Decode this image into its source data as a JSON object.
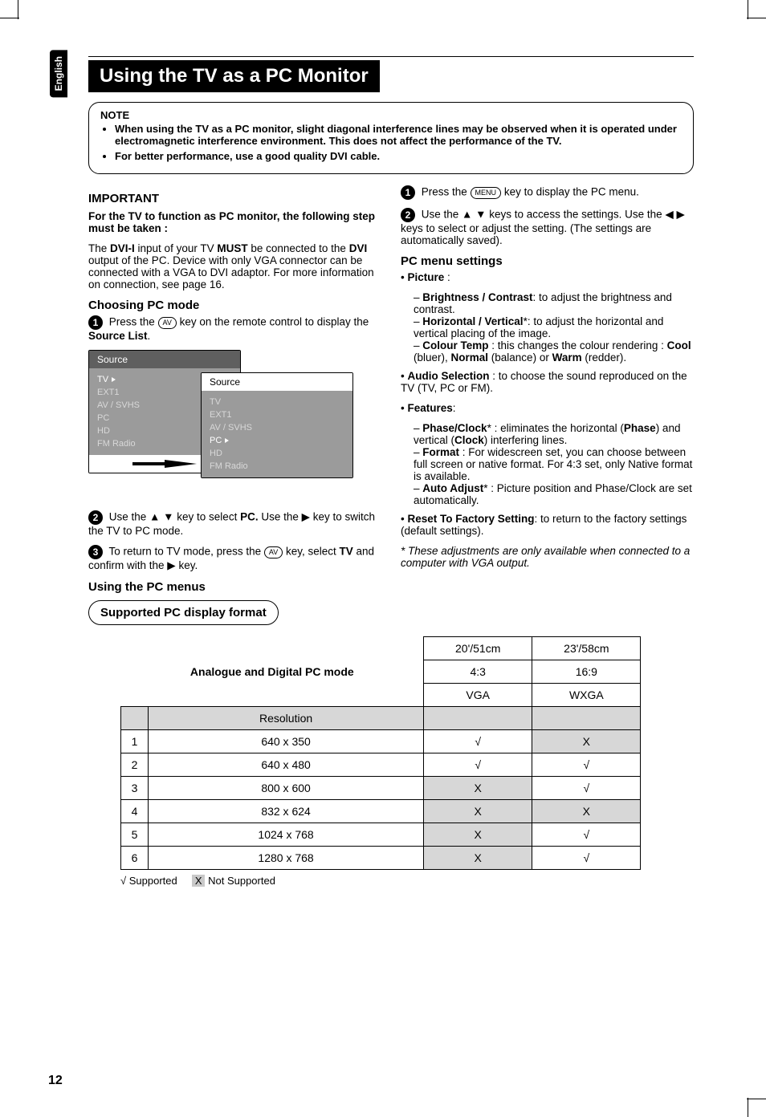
{
  "side": {
    "lang": "English"
  },
  "page": {
    "number": "12"
  },
  "title": "Using the TV as a PC Monitor",
  "note": {
    "label": "NOTE",
    "item1": "When using the TV as a PC monitor, slight diagonal interference lines may be observed when it is operated under electromagnetic interference environment. This does not affect the performance of the TV.",
    "item2": "For better performance, use a good quality DVI cable."
  },
  "left": {
    "important": "IMPORTANT",
    "important_body": "For the TV to function as PC monitor, the following step must be taken :",
    "dvi_para_a": "The ",
    "dvi_para_b": "DVI-I",
    "dvi_para_c": " input of your TV ",
    "dvi_para_d": "MUST",
    "dvi_para_e": " be connected to the ",
    "dvi_para_f": "DVI",
    "dvi_para_g": " output of the PC. Device with only VGA connector can be connected with a VGA to DVI adaptor. For more information on connection, see page 16.",
    "choosing_head": "Choosing PC mode",
    "step1_a": "Press the ",
    "step1_b": " key on the remote control to display the ",
    "step1_c": "Source List",
    "step1_d": ".",
    "key_av": "AV",
    "source_title": "Source",
    "source_rows": [
      "TV",
      "EXT1",
      "AV / SVHS",
      "PC",
      "HD",
      "FM Radio"
    ],
    "step2_a": "Use the ",
    "step2_b": " key to select ",
    "step2_c": "PC.",
    "step2_d": " Use the ",
    "step2_e": " key to switch the TV to PC mode.",
    "step3_a": "To return to TV mode, press the ",
    "step3_b": " key, select ",
    "step3_c": "TV",
    "step3_d": " and confirm with the ",
    "step3_e": " key.",
    "using_head": "Using the PC menus",
    "supported_head": "Supported PC display format"
  },
  "right": {
    "r1_a": "Press the ",
    "r1_b": " key to display the PC menu.",
    "key_menu": "MENU",
    "r2_a": "Use the ",
    "r2_b": " keys to access the settings. Use the ",
    "r2_c": " keys to select or adjust the setting. (The settings are automatically saved).",
    "pcmenu_head": "PC menu settings",
    "picture_label": "Picture",
    "picture_b1_a": "Brightness / Contrast",
    "picture_b1_b": ": to adjust the brightness and contrast.",
    "picture_b2_a": "Horizontal / Vertical",
    "picture_b2_b": "*: to adjust the horizontal and vertical placing of the image.",
    "picture_b3_a": "Colour Temp",
    "picture_b3_b": " : this changes the colour rendering : ",
    "picture_b3_c": "Cool",
    "picture_b3_d": " (bluer), ",
    "picture_b3_e": "Normal",
    "picture_b3_f": " (balance) or ",
    "picture_b3_g": "Warm",
    "picture_b3_h": " (redder).",
    "audio_a": "Audio Selection",
    "audio_b": " : to choose the sound reproduced on the TV (TV, PC or FM).",
    "features_label": "Features",
    "features_colon": ":",
    "feat_b1_a": "Phase/Clock",
    "feat_b1_b": "* : eliminates the horizontal (",
    "feat_b1_c": "Phase",
    "feat_b1_d": ") and vertical (",
    "feat_b1_e": "Clock",
    "feat_b1_f": ") interfering lines.",
    "feat_b2_a": "Format",
    "feat_b2_b": " : For widescreen set, you can choose between full screen or native format. For 4:3 set, only Native format is available.",
    "feat_b3_a": "Auto Adjust",
    "feat_b3_b": "* : Picture position and Phase/Clock are set automatically.",
    "reset_a": "Reset To Factory Setting",
    "reset_b": ": to return to the factory settings (default settings).",
    "footnote": "* These adjustments are only available when connected to a computer with VGA output."
  },
  "chart_data": {
    "type": "table",
    "header_title": "Analogue and Digital PC mode",
    "columns": [
      {
        "screen": "20'/51cm",
        "aspect": "4:3",
        "res_type": "VGA"
      },
      {
        "screen": "23'/58cm",
        "aspect": "16:9",
        "res_type": "WXGA"
      }
    ],
    "row_label": "Resolution",
    "rows": [
      {
        "n": "1",
        "res": "640 x 350",
        "c1": "√",
        "c2": "X"
      },
      {
        "n": "2",
        "res": "640 x 480",
        "c1": "√",
        "c2": "√"
      },
      {
        "n": "3",
        "res": "800 x 600",
        "c1": "X",
        "c2": "√"
      },
      {
        "n": "4",
        "res": "832 x 624",
        "c1": "X",
        "c2": "X"
      },
      {
        "n": "5",
        "res": "1024 x 768",
        "c1": "X",
        "c2": "√"
      },
      {
        "n": "6",
        "res": "1280 x 768",
        "c1": "X",
        "c2": "√"
      }
    ],
    "legend_ok": "√",
    "legend_ok_text": " Supported",
    "legend_bad": "X",
    "legend_bad_text": " Not Supported"
  }
}
